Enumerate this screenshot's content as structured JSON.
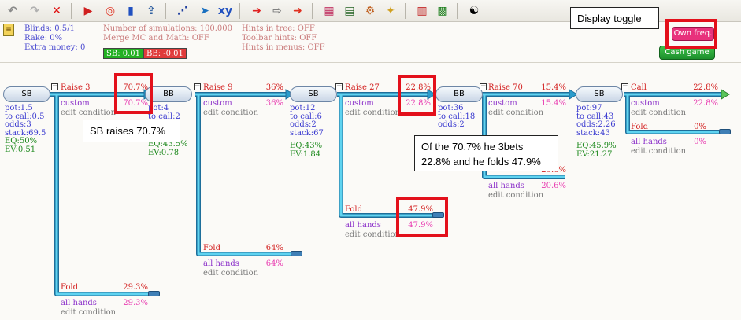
{
  "toolbar": {
    "buttons": [
      {
        "name": "undo-icon",
        "glyph": "↶",
        "color": "#8a8a8a"
      },
      {
        "name": "redo-icon",
        "glyph": "↷",
        "color": "#b0b0b0"
      },
      {
        "name": "delete-icon",
        "glyph": "✕",
        "color": "#e01010"
      },
      {
        "name": "run-icon",
        "glyph": "▶",
        "color": "#d02020"
      },
      {
        "name": "ring-icon",
        "glyph": "◎",
        "color": "#e03020"
      },
      {
        "name": "chart-icon",
        "glyph": "▮",
        "color": "#2050c0"
      },
      {
        "name": "export-icon",
        "glyph": "⇪",
        "color": "#3060a0"
      },
      {
        "name": "scatter-icon",
        "glyph": "⋰",
        "color": "#2040a0"
      },
      {
        "name": "play-circle-icon",
        "glyph": "➤",
        "color": "#1a70c0"
      },
      {
        "name": "xy-icon",
        "glyph": "xy",
        "color": "#2050c0"
      },
      {
        "name": "arrow-red-icon",
        "glyph": "➔",
        "color": "#e02020"
      },
      {
        "name": "arrow-white-icon",
        "glyph": "⇨",
        "color": "#808080"
      },
      {
        "name": "arrow-forward-icon",
        "glyph": "➜",
        "color": "#e03020"
      },
      {
        "name": "grid-icon",
        "glyph": "▦",
        "color": "#c03060"
      },
      {
        "name": "table-icon",
        "glyph": "▤",
        "color": "#206020"
      },
      {
        "name": "settings-icon",
        "glyph": "⚙",
        "color": "#c06020"
      },
      {
        "name": "puzzle-icon",
        "glyph": "✦",
        "color": "#d0a020"
      },
      {
        "name": "report-icon",
        "glyph": "▥",
        "color": "#c02020"
      },
      {
        "name": "excel-icon",
        "glyph": "▩",
        "color": "#208020"
      },
      {
        "name": "yin-yang-icon",
        "glyph": "☯",
        "color": "#000000"
      }
    ]
  },
  "info": {
    "blinds": "Blinds: 0.5/1",
    "rake": "Rake: 0%",
    "extra_money": "Extra money: 0",
    "simulations": "Number of simulations: 100.000",
    "merge": "Merge MC and Math: OFF",
    "hints_tree": "Hints in tree: OFF",
    "toolbar_hints": "Toolbar hints: OFF",
    "hints_menus": "Hints in menus: OFF",
    "sb_badge": "SB: 0.01",
    "bb_badge": "BB: -0.01"
  },
  "buttons": {
    "own_freq": "Own freq.",
    "cash_game": "Cash game"
  },
  "nodes": [
    {
      "label": "SB",
      "stats": [
        "pot:1.5",
        "to call:0.5",
        "odds:3",
        "stack:69.5"
      ],
      "eq": "EQ:50%",
      "ev": "EV:0.51"
    },
    {
      "label": "BB",
      "stats": [
        "pot:4",
        "to call:2",
        "odds:2",
        ""
      ],
      "eq": "EQ:43.5%",
      "ev": "EV:0.78"
    },
    {
      "label": "SB",
      "stats": [
        "pot:12",
        "to call:6",
        "odds:2",
        "stack:67"
      ],
      "eq": "EQ:43%",
      "ev": "EV:1.84"
    },
    {
      "label": "BB",
      "stats": [
        "pot:36",
        "to call:18",
        "odds:2",
        ""
      ],
      "eq": "",
      "ev": ""
    },
    {
      "label": "SB",
      "stats": [
        "pot:97",
        "to call:43",
        "odds:2.26",
        "stack:43"
      ],
      "eq": "EQ:45.9%",
      "ev": "EV:21.27"
    }
  ],
  "actions": [
    {
      "label": "Raise 3",
      "pct": "70.7%",
      "hand": "custom",
      "hand_pct": "70.7%",
      "edit": "edit condition"
    },
    {
      "label": "Fold",
      "pct": "29.3%",
      "hand": "all hands",
      "hand_pct": "29.3%",
      "edit": "edit condition"
    },
    {
      "label": "Raise 9",
      "pct": "36%",
      "hand": "custom",
      "hand_pct": "36%",
      "edit": "edit condition"
    },
    {
      "label": "Fold",
      "pct": "64%",
      "hand": "all hands",
      "hand_pct": "64%",
      "edit": "edit condition"
    },
    {
      "label": "Raise 27",
      "pct": "22.8%",
      "hand": "custom",
      "hand_pct": "22.8%",
      "edit": "edit condition"
    },
    {
      "label": "Fold",
      "pct": "47.9%",
      "hand": "all hands",
      "hand_pct": "47.9%",
      "edit": "edit condition"
    },
    {
      "label": "Raise 70",
      "pct": "15.4%",
      "hand": "custom",
      "hand_pct": "15.4%",
      "edit": "edit condition"
    },
    {
      "label": "",
      "pct": "20.6%",
      "hand": "all hands",
      "hand_pct": "20.6%",
      "edit": "edit condition"
    },
    {
      "label": "Call",
      "pct": "22.8%",
      "hand": "custom",
      "hand_pct": "22.8%",
      "edit": "edit condition"
    },
    {
      "label": "Fold",
      "pct": "0%",
      "hand": "all hands",
      "hand_pct": "0%",
      "edit": "edit condition"
    }
  ],
  "annotations": {
    "display_toggle": "Display toggle",
    "sb_raises": "SB raises 70.7%",
    "threebet_line1": "Of the 70.7% he 3bets",
    "threebet_line2": "22.8% and he folds 47.9%"
  },
  "colors": {
    "line_fill": "#5fd3f0",
    "line_edge": "#1d6e9a",
    "action_red": "#d32020",
    "hand_purple": "#8b2fc9",
    "hand_pink": "#e83ab0",
    "annotation_red": "#e3101b",
    "own_freq_pink": "#e8317c",
    "cash_green": "#1d8f2c"
  }
}
